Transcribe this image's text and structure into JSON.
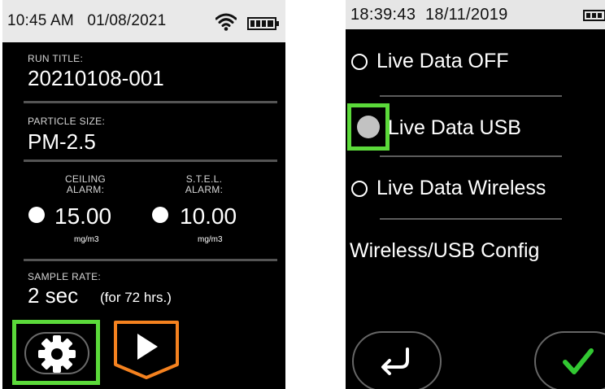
{
  "left_device": {
    "status_bar": {
      "time": "10:45 AM",
      "date": "01/08/2021",
      "wifi_icon": "wifi-icon",
      "battery_icon": "battery-icon"
    },
    "run_title": {
      "label": "RUN TITLE:",
      "value": "20210108-001"
    },
    "particle_size": {
      "label": "PARTICLE SIZE:",
      "value": "PM-2.5"
    },
    "ceiling_alarm": {
      "label_line1": "CEILING",
      "label_line2": "ALARM:",
      "value": "15.00",
      "unit": "mg/m3"
    },
    "stel_alarm": {
      "label_line1": "S.T.E.L.",
      "label_line2": "ALARM:",
      "value": "10.00",
      "unit": "mg/m3"
    },
    "sample_rate": {
      "label": "SAMPLE RATE:",
      "value": "2 sec",
      "note": "(for 72 hrs.)"
    },
    "buttons": {
      "settings_icon": "gear-icon",
      "start_icon": "play-icon"
    },
    "highlight_color": "#5bd93a",
    "start_button_color": "#f5821f"
  },
  "right_device": {
    "status_bar": {
      "time": "18:39:43",
      "date": "18/11/2019",
      "battery_icon": "battery-icon"
    },
    "options": [
      {
        "label": "Live Data OFF",
        "selected": false
      },
      {
        "label": "Live Data USB",
        "selected": true
      },
      {
        "label": "Live Data Wireless",
        "selected": false
      }
    ],
    "config_label": "Wireless/USB Config",
    "buttons": {
      "back_icon": "return-arrow-icon",
      "confirm_icon": "check-icon"
    },
    "highlight_color": "#5bd93a",
    "confirm_color": "#32c832"
  }
}
